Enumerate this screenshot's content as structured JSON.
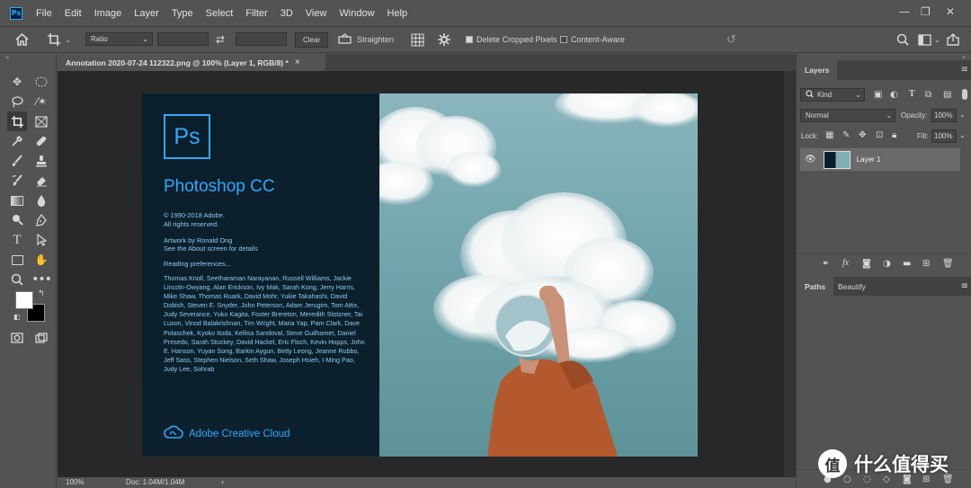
{
  "menubar": {
    "logo": "Ps",
    "items": [
      "File",
      "Edit",
      "Image",
      "Layer",
      "Type",
      "Select",
      "Filter",
      "3D",
      "View",
      "Window",
      "Help"
    ],
    "window_controls": {
      "minimize": "—",
      "restore": "❐",
      "close": "✕"
    }
  },
  "options": {
    "ratio_label": "Ratio",
    "clear_label": "Clear",
    "straighten_label": "Straighten",
    "delete_cropped_label": "Delete Cropped Pixels",
    "delete_cropped_checked": true,
    "content_aware_label": "Content-Aware",
    "content_aware_checked": false
  },
  "document_tab": {
    "title": "Annotation 2020-07-24 112322.png @ 100% (Layer 1, RGB/8) *",
    "close": "×"
  },
  "splash": {
    "logo": "Ps",
    "product": "Photoshop CC",
    "copyright": "© 1990-2018 Adobe.",
    "rights": "All rights reserved.",
    "artwork": "Artwork by Ronald Ong",
    "about": "See the About screen for details",
    "reading": "Reading preferences...",
    "credits": "Thomas Knoll, Seetharaman Narayanan, Russell Williams, Jackie Lincoln-Owyang, Alan Erickson, Ivy Mak, Sarah Kong, Jerry Harris, Mike Shaw, Thomas Ruark, David Mohr, Yukie Takahashi, David Dobish, Steven E. Snyder, John Peterson, Adam Jerugim, Tom Attix, Judy Severance, Yuko Kagita, Foster Brereton, Meredith Stotzner, Tai Luxon, Vinod Balakrishnan, Tim Wright, Maria Yap, Pam Clark, Dave Polaschek, Kyoko Itoda, Kellisa Sandoval, Steve Guilhamet, Daniel Presedo, Sarah Stuckey, David Hackel, Eric Floch, Kevin Hopps, John E. Hanson, Yuyan Song, Barkin Aygun, Betty Leong, Jeanne Rubbo, Jeff Sass, Stephen Nielson, Seth Shaw, Joseph Hsieh, I-Ming Pao, Judy Lee, Sohrab",
    "cloud": "Adobe Creative Cloud"
  },
  "status": {
    "zoom": "100%",
    "doc": "Doc: 1.04M/1.04M",
    "arrow": "›"
  },
  "layers_panel": {
    "tab": "Layers",
    "kind": "Kind",
    "blend": "Normal",
    "opacity_label": "Opacity:",
    "opacity_value": "100%",
    "lock_label": "Lock:",
    "fill_label": "Fill:",
    "fill_value": "100%",
    "layer_name": "Layer 1"
  },
  "paths_panel": {
    "tabs": [
      "Paths",
      "Beautify"
    ]
  },
  "watermark": {
    "icon": "值",
    "text": "什么值得买"
  },
  "colors": {
    "accent": "#31a8ff",
    "ui_bg": "#535353",
    "canvas_bg": "#282828",
    "splash_bg": "#0b1f2b"
  }
}
